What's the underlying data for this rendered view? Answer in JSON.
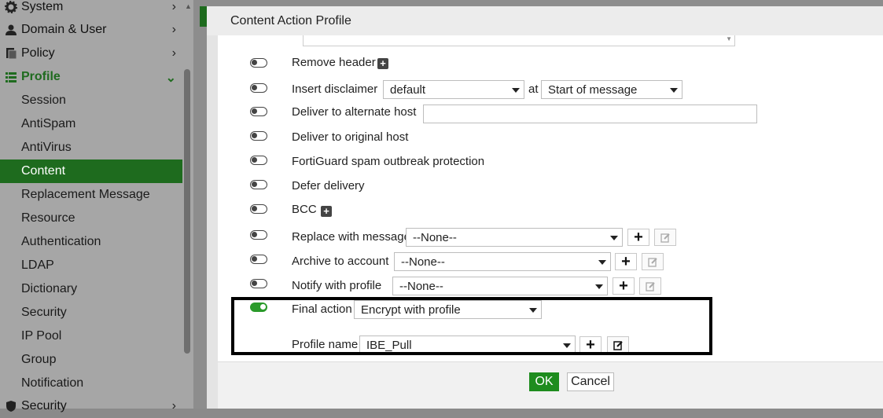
{
  "sidebar": {
    "top_items": [
      {
        "label": "System",
        "icon": "gear-icon"
      },
      {
        "label": "Domain & User",
        "icon": "user-icon"
      },
      {
        "label": "Policy",
        "icon": "policy-icon"
      },
      {
        "label": "Profile",
        "icon": "list-icon"
      }
    ],
    "profile_items": [
      {
        "label": "Session"
      },
      {
        "label": "AntiSpam"
      },
      {
        "label": "AntiVirus"
      },
      {
        "label": "Content"
      },
      {
        "label": "Replacement Message"
      },
      {
        "label": "Resource"
      },
      {
        "label": "Authentication"
      },
      {
        "label": "LDAP"
      },
      {
        "label": "Dictionary"
      },
      {
        "label": "Security"
      },
      {
        "label": "IP Pool"
      },
      {
        "label": "Group"
      },
      {
        "label": "Notification"
      }
    ],
    "bottom_item": {
      "label": "Security",
      "icon": "shield-icon"
    },
    "active_item": "Content",
    "accent_color": "#1e6b1e"
  },
  "dialog": {
    "title": "Content Action Profile",
    "rows": {
      "remove_header": {
        "label": "Remove header",
        "enabled": false
      },
      "insert_disclaimer": {
        "label": "Insert disclaimer",
        "enabled": false,
        "value": "default",
        "at_label": "at",
        "position_value": "Start of message"
      },
      "deliver_alternate": {
        "label": "Deliver to alternate host",
        "enabled": false,
        "value": ""
      },
      "deliver_original": {
        "label": "Deliver to original host",
        "enabled": false
      },
      "fortiguard": {
        "label": "FortiGuard spam outbreak protection",
        "enabled": false
      },
      "defer": {
        "label": "Defer delivery",
        "enabled": false
      },
      "bcc": {
        "label": "BCC",
        "enabled": false
      },
      "replace_message": {
        "label": "Replace with message",
        "enabled": false,
        "value": "--None--"
      },
      "archive_account": {
        "label": "Archive to account",
        "enabled": false,
        "value": "--None--"
      },
      "notify_profile": {
        "label": "Notify with profile",
        "enabled": false,
        "value": "--None--"
      },
      "final_action": {
        "label": "Final action",
        "enabled": true,
        "value": "Encrypt with profile"
      },
      "profile_name": {
        "label": "Profile name",
        "value": "IBE_Pull"
      }
    },
    "ok_label": "OK",
    "cancel_label": "Cancel",
    "ok_color": "#1e8c1e",
    "toggle_on_color": "#2a9a2a"
  }
}
